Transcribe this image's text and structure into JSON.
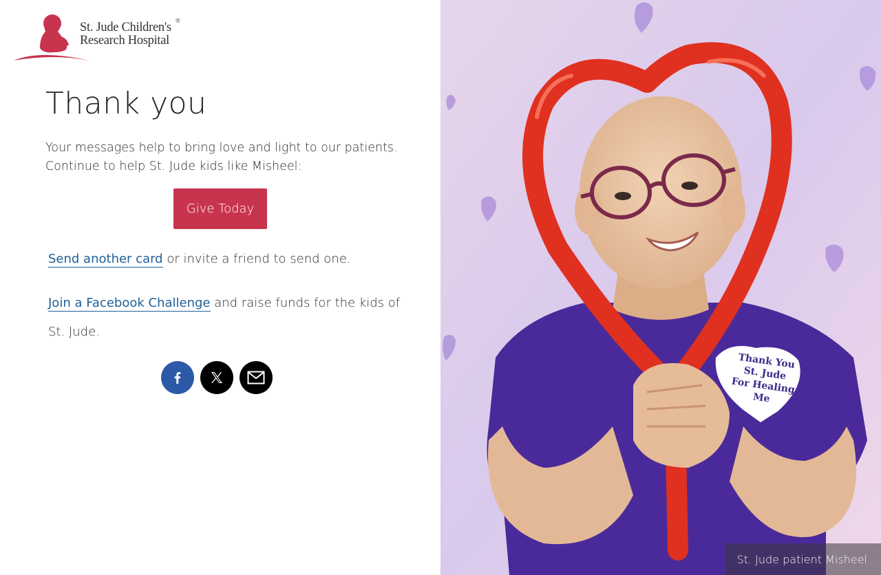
{
  "logo": {
    "line1": "St. Jude Children's",
    "line2": "Research Hospital",
    "registered": "®",
    "color": "#c8334e"
  },
  "title": "Thank you",
  "intro": {
    "line1": "Your messages help to bring love and light to our patients.",
    "line2": "Continue to help St. Jude kids like Misheel:"
  },
  "give_button": {
    "label": "Give Today",
    "color": "#c8334e"
  },
  "send_card": {
    "link": "Send another card",
    "rest": " or invite a friend to send one."
  },
  "facebook_challenge": {
    "link": "Join a Facebook Challenge",
    "rest": " and raise funds for the kids of St. Jude."
  },
  "social": [
    {
      "icon": "facebook-icon",
      "color": "#2d5aa8"
    },
    {
      "icon": "x-icon",
      "color": "#000000"
    },
    {
      "icon": "mail-icon",
      "color": "#000000"
    }
  ],
  "photo": {
    "badge": {
      "line1": "Thank You",
      "line2": "St. Jude",
      "line3": "For Healing",
      "line4": "Me"
    },
    "caption": "St. Jude patient Misheel"
  },
  "colors": {
    "link": "#1f5f99",
    "shirt": "#4a2a9a",
    "balloon": "#e0301f"
  }
}
